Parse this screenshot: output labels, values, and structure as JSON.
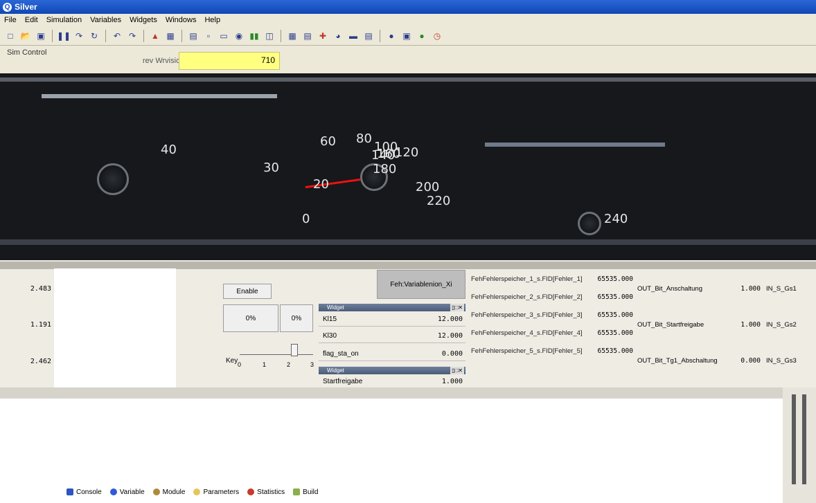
{
  "window": {
    "title": "Silver",
    "app_icon": "silver-app-icon"
  },
  "menu": [
    "File",
    "Edit",
    "Simulation",
    "Variables",
    "Widgets",
    "Windows",
    "Help"
  ],
  "toolbar_icons": [
    "new-icon",
    "open-icon",
    "save-icon",
    "pause-icon",
    "step-icon",
    "reload-icon",
    "undo-icon",
    "redo-icon",
    "trace-icon",
    "config-icon",
    "widget-text-icon",
    "widget-label-icon",
    "widget-button-icon",
    "widget-radio-icon",
    "widget-bars-icon",
    "widget-plot-icon",
    "widget-table-icon",
    "widget-gauge-icon",
    "widget-chart-icon",
    "widget-image-icon",
    "widget-dot-icon",
    "widget-list-icon",
    "widget-save-icon",
    "widget-power-icon",
    "widget-clock-icon"
  ],
  "sim_toolbar": {
    "label": "Sim Control",
    "field_label": "rev Wrvision",
    "field_value": "710"
  },
  "dashboard": {
    "speedo_numbers": [
      "40",
      "30",
      "60",
      "80",
      "100",
      "120",
      "140",
      "160",
      "180",
      "200",
      "220",
      "240",
      "20",
      "0"
    ]
  },
  "left_values": [
    "2.483",
    "1.191",
    "2.462"
  ],
  "buttons": {
    "enable_label": "Enable",
    "pct_1": "0%",
    "pct_2": "0%",
    "key_label": "Key",
    "key_ticks": [
      "0",
      "1",
      "2",
      "3"
    ],
    "fehler_button": "Feh:Variablenion_Xi"
  },
  "widget_panel_1": {
    "title": "Widget",
    "rows": [
      {
        "label": "Kl15",
        "value": "12.000"
      },
      {
        "label": "Kl30",
        "value": "12.000"
      },
      {
        "label": "flag_sta_on",
        "value": "0.000"
      }
    ]
  },
  "widget_panel_2": {
    "title": "Widget",
    "rows": [
      {
        "label": "Startfreigabe",
        "value": "1.000"
      }
    ]
  },
  "fehler_table": [
    {
      "label": "FehFehlerspeicher_1_s.FID[Fehler_1]",
      "value": "65535.000"
    },
    {
      "label": "FehFehlerspeicher_2_s.FID[Fehler_2]",
      "value": "65535.000"
    },
    {
      "label": "FehFehlerspeicher_3_s.FID[Fehler_3]",
      "value": "65535.000"
    },
    {
      "label": "FehFehlerspeicher_4_s.FID[Fehler_4]",
      "value": "65535.000"
    },
    {
      "label": "FehFehlerspeicher_5_s.FID[Fehler_5]",
      "value": "65535.000"
    }
  ],
  "out_table": [
    {
      "label": "OUT_Bit_Anschaltung",
      "value": "1.000",
      "channel": "IN_S_Gs1"
    },
    {
      "label": "OUT_Bit_Startfreigabe",
      "value": "1.000",
      "channel": "IN_S_Gs2"
    },
    {
      "label": "OUT_Bit_Tg1_Abschaltung",
      "value": "0.000",
      "channel": "IN_S_Gs3"
    }
  ],
  "bottom_tabs": [
    {
      "label": "Console",
      "icon": "console-icon",
      "color": "#2b55c0"
    },
    {
      "label": "Variable",
      "icon": "variable-icon",
      "color": "#2f5bd8"
    },
    {
      "label": "Module",
      "icon": "module-icon",
      "color": "#b08a3a"
    },
    {
      "label": "Parameters",
      "icon": "parameters-icon",
      "color": "#e5c65a"
    },
    {
      "label": "Statistics",
      "icon": "statistics-icon",
      "color": "#c83a2a"
    },
    {
      "label": "Build",
      "icon": "build-icon",
      "color": "#8ab04a"
    }
  ]
}
